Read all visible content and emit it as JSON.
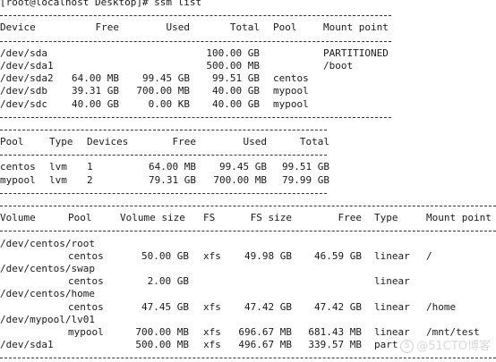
{
  "prompt": "[root@localhost Desktop]# ssm list",
  "devices": {
    "headers": [
      "Device",
      "Free",
      "Used",
      "Total",
      "Pool",
      "Mount point"
    ],
    "rows": [
      [
        "/dev/sda",
        "",
        "",
        "100.00 GB",
        "",
        "PARTITIONED"
      ],
      [
        "/dev/sda1",
        "",
        "",
        "500.00 MB",
        "",
        "/boot"
      ],
      [
        "/dev/sda2",
        "64.00 MB",
        "99.45 GB",
        "99.51 GB",
        "centos",
        ""
      ],
      [
        "/dev/sdb",
        "39.31 GB",
        "700.00 MB",
        "40.00 GB",
        "mypool",
        ""
      ],
      [
        "/dev/sdc",
        "40.00 GB",
        "0.00 KB",
        "40.00 GB",
        "mypool",
        ""
      ]
    ]
  },
  "pools": {
    "headers": [
      "Pool",
      "Type",
      "Devices",
      "Free",
      "Used",
      "Total"
    ],
    "rows": [
      [
        "centos",
        "lvm",
        "1",
        "64.00 MB",
        "99.45 GB",
        "99.51 GB"
      ],
      [
        "mypool",
        "lvm",
        "2",
        "79.31 GB",
        "700.00 MB",
        "79.99 GB"
      ]
    ]
  },
  "volumes": {
    "headers": [
      "Volume",
      "Pool",
      "Volume size",
      "FS",
      "FS size",
      "Free",
      "Type",
      "Mount point"
    ],
    "entries": [
      {
        "volume": "/dev/centos/root",
        "pool": "centos",
        "size": "50.00 GB",
        "fs": "xfs",
        "fs_size": "49.98 GB",
        "free": "46.59 GB",
        "type": "linear",
        "mount": "/"
      },
      {
        "volume": "/dev/centos/swap",
        "pool": "centos",
        "size": "2.00 GB",
        "fs": "",
        "fs_size": "",
        "free": "",
        "type": "linear",
        "mount": ""
      },
      {
        "volume": "/dev/centos/home",
        "pool": "centos",
        "size": "47.45 GB",
        "fs": "xfs",
        "fs_size": "47.42 GB",
        "free": "47.42 GB",
        "type": "linear",
        "mount": "/home"
      },
      {
        "volume": "/dev/mypool/lv01",
        "pool": "mypool",
        "size": "700.00 MB",
        "fs": "xfs",
        "fs_size": "696.67 MB",
        "free": "681.43 MB",
        "type": "linear",
        "mount": "/mnt/test"
      }
    ],
    "last_row": [
      "/dev/sda1",
      "500.00 MB",
      "xfs",
      "496.67 MB",
      "339.57 MB",
      "part"
    ]
  },
  "watermark": "@51CTO博客"
}
